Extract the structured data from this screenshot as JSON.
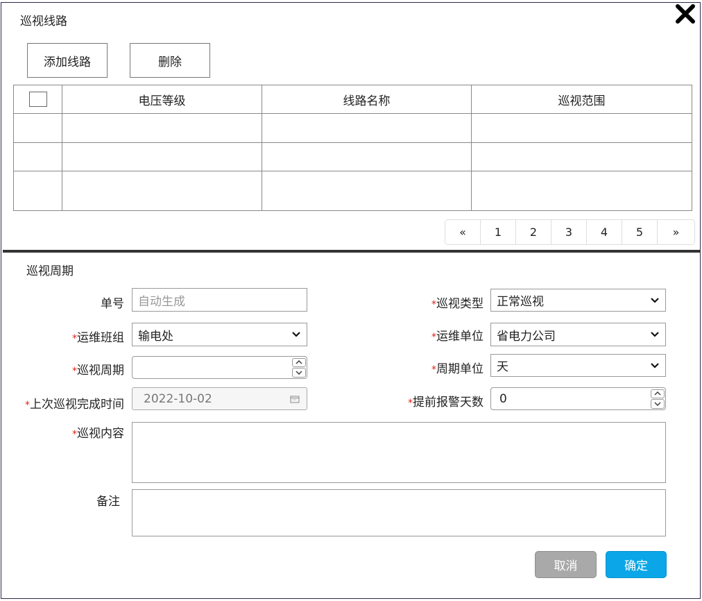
{
  "dialog": {
    "section1_title": "巡视线路",
    "add_button": "添加线路",
    "delete_button": "删除",
    "close_icon": "close-icon"
  },
  "table": {
    "headers": [
      "电压等级",
      "线路名称",
      "巡视范围"
    ],
    "rows": [
      [
        "",
        "",
        ""
      ],
      [
        "",
        "",
        ""
      ],
      [
        "",
        "",
        ""
      ]
    ]
  },
  "pagination": [
    "«",
    "1",
    "2",
    "3",
    "4",
    "5",
    "»"
  ],
  "form": {
    "section2_title": "巡视周期",
    "order_no": {
      "label": "单号",
      "placeholder": "自动生成"
    },
    "patrol_type": {
      "label": "巡视类型",
      "value": "正常巡视"
    },
    "team": {
      "label": "运维班组",
      "value": "输电处"
    },
    "unit": {
      "label": "运维单位",
      "value": "省电力公司"
    },
    "cycle": {
      "label": "巡视周期",
      "value": ""
    },
    "cycle_unit": {
      "label": "周期单位",
      "value": "天"
    },
    "last_time": {
      "label": "上次巡视完成时间",
      "value": "2022-10-02"
    },
    "advance_days": {
      "label": "提前报警天数",
      "value": "0"
    },
    "content": {
      "label": "巡视内容"
    },
    "remark": {
      "label": "备注"
    },
    "required_mark": "*"
  },
  "footer": {
    "cancel": "取消",
    "confirm": "确定"
  },
  "colors": {
    "confirm_bg": "#0aa6e8",
    "cancel_bg": "#a9a9a9",
    "required": "#d9241b"
  }
}
